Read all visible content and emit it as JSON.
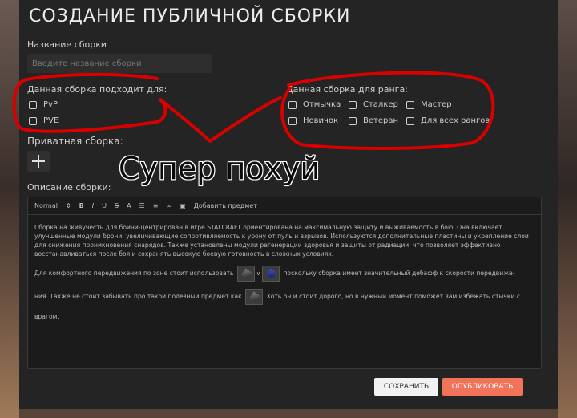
{
  "modal": {
    "title": "СОЗДАНИЕ ПУБЛИЧНОЙ СБОРКИ"
  },
  "build_name": {
    "label": "Название сборки",
    "placeholder": "Введите название сборки"
  },
  "suitable_for": {
    "label": "Данная сборка подходит для:",
    "options": [
      "PvP",
      "PVE"
    ]
  },
  "rank": {
    "label": "Данная сборка для ранга:",
    "options": [
      "Отмычка",
      "Сталкер",
      "Мастер",
      "Новичок",
      "Ветеран",
      "Для всех рангов"
    ]
  },
  "private": {
    "label": "Приватная сборка:"
  },
  "description": {
    "label": "Описание сборки:",
    "toolbar": {
      "format": "Normal",
      "bold": "B",
      "italic": "I",
      "underline": "U",
      "strike": "S",
      "add_item": "Добавить предмет"
    },
    "text_p1": "Сборка на живучесть для бойни-центрирован в игре STALCRAFT ориентирована на максимальную защиту и выживаемость в бою. Она включает улучшенные модули брони, увеличивающие сопротивляемость к урону от пуль и взрывов. Используются дополнительные пластины и укрепление слои для снижения проникновения снарядов. Также установлены модули регенерации здоровья и защиты от радиации, что позволяет эффективно восстанавливаться после боя и сохранять высокую боевую готовность в сложных условиях.",
    "text_p2a": "Для комфортного передвижения по зоне стоит использовать",
    "text_p2b": "поскольку сборка имеет значительный дебафф к скорости передвиже-",
    "text_p3a": "ния. Также не стоит забывать про такой полезный предмет как",
    "text_p3b": "Хоть он и стоит дорого, но в нужный момент поможет вам избежать стычки с",
    "text_p4": "врагом."
  },
  "overlay_caption": "Супер похуй",
  "buttons": {
    "save": "СОХРАНИТЬ",
    "publish": "ОПУБЛИКОВАТЬ"
  },
  "colors": {
    "accent": "#f0735a",
    "scribble": "#d90000",
    "modal_bg": "#242424"
  }
}
